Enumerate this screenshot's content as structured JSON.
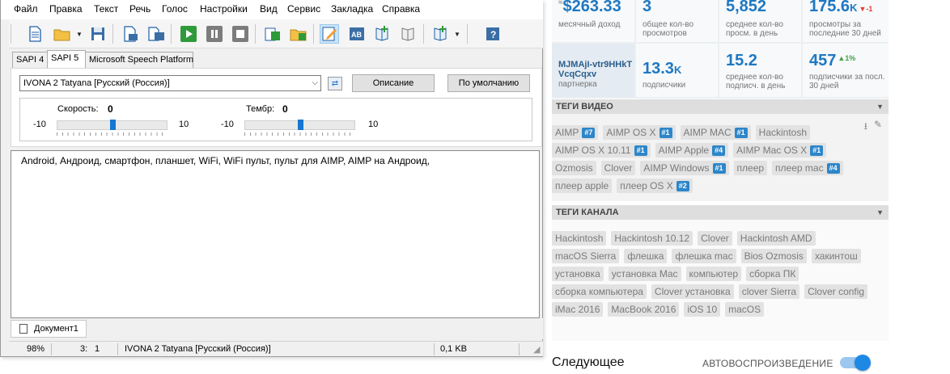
{
  "app": {
    "menu": [
      "Файл",
      "Правка",
      "Текст",
      "Речь",
      "Голос",
      "Настройки",
      "Вид",
      "Сервис",
      "Закладка",
      "Справка"
    ],
    "tabs": [
      "SAPI 4",
      "SAPI 5",
      "Microsoft Speech Platform"
    ],
    "voice_selected": "IVONA 2 Tatyana [Русский (Россия)]",
    "describe_button": "Описание",
    "default_button": "По умолчанию",
    "speed": {
      "label": "Скорость:",
      "value": "0",
      "min": "-10",
      "max": "10",
      "level": 0
    },
    "pitch": {
      "label": "Тембр:",
      "value": "0",
      "min": "-10",
      "max": "10",
      "level": 0
    },
    "editor_text": "Android, Андроид, смартфон, планшет, WiFi, WiFi пульт, пульт для AIMP, AIMP на Андроид,",
    "document_tab": "Документ1",
    "status": {
      "zoom": "98%",
      "line": "3:",
      "col": "1",
      "voice": "IVONA 2 Tatyana [Русский (Россия)]",
      "size": "0,1 KB"
    }
  },
  "stats": {
    "monthly_income": {
      "value": "$263.33",
      "label": "месячный доход",
      "prefix": "≈"
    },
    "total_views": {
      "value": "3",
      "label": "общее кол-во просмотров"
    },
    "avg_views": {
      "value": "5,852",
      "label": "среднее кол-во просм. в день"
    },
    "views30": {
      "value": "175.6",
      "suffix": "K",
      "delta": "▼-1",
      "label": "просмотры за последние 30 дней"
    },
    "partner": {
      "value": "MJMAjI-vtr9HHkTVcqCqxv",
      "label": "партнерка"
    },
    "subscribers": {
      "value": "13.3",
      "suffix": "K",
      "label": "подписчики"
    },
    "avg_subs": {
      "value": "15.2",
      "label": "среднее кол-во подписч. в день"
    },
    "subs30": {
      "value": "457",
      "delta": "▲1%",
      "label": "подписчики за посл. 30 дней"
    }
  },
  "video_tags": {
    "title": "ТЕГИ ВИДЕО",
    "items": [
      {
        "text": "AIMP",
        "badge": "#7"
      },
      {
        "text": "AIMP OS X",
        "badge": "#1"
      },
      {
        "text": "AIMP MAC",
        "badge": "#1"
      },
      {
        "text": "Hackintosh",
        "badge": ""
      },
      {
        "text": "AIMP OS X 10.11",
        "badge": "#1"
      },
      {
        "text": "AIMP Apple",
        "badge": "#4"
      },
      {
        "text": "AIMP Mac OS X",
        "badge": "#1"
      },
      {
        "text": "Ozmosis",
        "badge": ""
      },
      {
        "text": "Clover",
        "badge": ""
      },
      {
        "text": "AIMP Windows",
        "badge": "#1"
      },
      {
        "text": "плеер",
        "badge": ""
      },
      {
        "text": "плеер mac",
        "badge": "#4"
      },
      {
        "text": "плеер apple",
        "badge": ""
      },
      {
        "text": "плеер OS X",
        "badge": "#2"
      }
    ]
  },
  "channel_tags": {
    "title": "ТЕГИ КАНАЛА",
    "items": [
      "Hackintosh",
      "Hackintosh 10.12",
      "Clover",
      "Hackintosh AMD",
      "macOS Sierra",
      "флешка",
      "флешка mac",
      "Bios Ozmosis",
      "хакинтош",
      "установка",
      "установка Mac",
      "компьютер",
      "сборка ПК",
      "сборка компьютера",
      "Clover установка",
      "clover Sierra",
      "Clover config",
      "iMac 2016",
      "MacBook 2016",
      "iOS 10",
      "macOS"
    ]
  },
  "next_label": "Следующее",
  "autoplay_label": "АВТОВОСПРОИЗВЕДЕНИЕ",
  "autoplay_on": true,
  "colors": {
    "accent": "#1e78c2",
    "badge": "#2d86c9",
    "negative": "#e53935",
    "positive": "#43a047"
  }
}
